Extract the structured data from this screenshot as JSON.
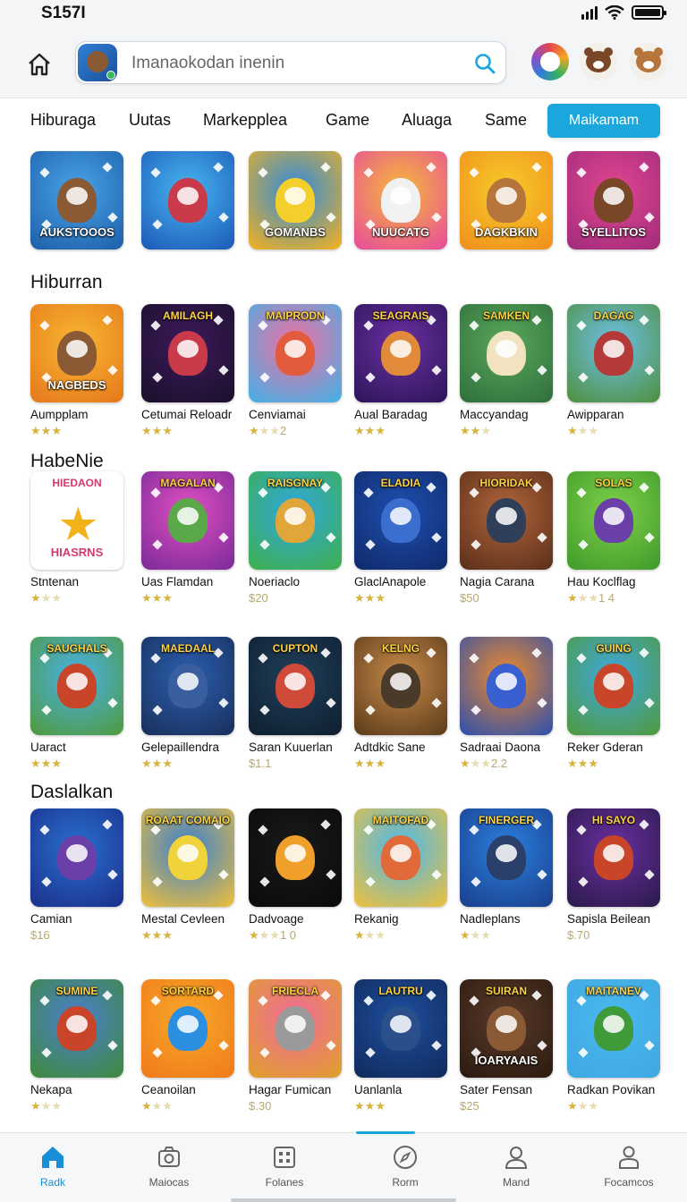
{
  "status_bar": {
    "time": "S157I"
  },
  "search": {
    "placeholder": "Imanaokodan inenin"
  },
  "tabs": [
    {
      "label": "Hiburaga"
    },
    {
      "label": "Uutas"
    },
    {
      "label": "Markepplea"
    },
    {
      "label": "Game"
    },
    {
      "label": "Aluaga"
    },
    {
      "label": "Same"
    },
    {
      "label": "Maikamam",
      "active": true
    }
  ],
  "featured": [
    {
      "banner_bottom": "AUKSTOOOS",
      "colors": [
        "#4aa3e8",
        "#1c5fa8"
      ],
      "char": "#8a5a34"
    },
    {
      "banner_bottom": "",
      "colors": [
        "#49b6f0",
        "#1b58b8"
      ],
      "char": "#c93a4a"
    },
    {
      "banner_bottom": "GOMANBS",
      "colors": [
        "#2d8be0",
        "#f6b21c"
      ],
      "char": "#f3cf2c"
    },
    {
      "banner_bottom": "NUUCATG",
      "colors": [
        "#f5b93a",
        "#e84a9c"
      ],
      "char": "#f1f1f1"
    },
    {
      "banner_bottom": "DAGKBKIN",
      "colors": [
        "#f7cb2a",
        "#f08e1c"
      ],
      "char": "#b5753b"
    },
    {
      "banner_bottom": "SYELLITOS",
      "colors": [
        "#e0468f",
        "#a12b7c"
      ],
      "char": "#7a4628"
    }
  ],
  "sections": [
    {
      "title": "Hiburran",
      "items": [
        {
          "name": "Aumpplam",
          "rating": 3,
          "price": "",
          "banner_top": "",
          "banner_bottom": "NAGBEDS",
          "colors": [
            "#f7b731",
            "#e6771c"
          ],
          "char": "#8a5a34"
        },
        {
          "name": "Cetumai Reloadr",
          "rating": 3,
          "price": "",
          "banner_top": "AMILAGH",
          "banner_bottom": "",
          "colors": [
            "#3d1a5c",
            "#1a0f2a"
          ],
          "char": "#c93a4a"
        },
        {
          "name": "Cenviamai",
          "rating": 1,
          "price": "2",
          "banner_top": "MAIPRODN",
          "banner_bottom": "",
          "colors": [
            "#f26fa1",
            "#3fb2e8"
          ],
          "char": "#e35b3d"
        },
        {
          "name": "Aual Baradag",
          "rating": 3,
          "price": "",
          "banner_top": "SEAGRAIS",
          "banner_bottom": "",
          "colors": [
            "#6b2fa3",
            "#2b1557"
          ],
          "char": "#e08a3a"
        },
        {
          "name": "Maccyandag",
          "rating": 2,
          "price": "",
          "banner_top": "SAMKEN",
          "banner_bottom": "",
          "colors": [
            "#5aa85a",
            "#2f6e3d"
          ],
          "char": "#f1e3c0"
        },
        {
          "name": "Awipparan",
          "rating": 1,
          "price": "",
          "banner_top": "DAGAG",
          "banner_bottom": "",
          "colors": [
            "#6cc0e8",
            "#4f8f3c"
          ],
          "char": "#b43a3a"
        }
      ]
    },
    {
      "title": "HabeNie",
      "items": [
        {
          "name": "Stntenan",
          "rating": 1,
          "price": "",
          "banner_top": "HIEDAON",
          "banner_bottom": "HIASRNS",
          "colors": [
            "#ffffff",
            "#ffffff"
          ],
          "char": "",
          "star": true
        },
        {
          "name": "Uas Flamdan",
          "rating": 3,
          "price": "",
          "banner_top": "MAGALAN",
          "banner_bottom": "",
          "colors": [
            "#e04fc0",
            "#7a2a9a"
          ],
          "char": "#5aa84a"
        },
        {
          "name": "Noeriaclo",
          "rating": 0,
          "price": "$20",
          "banner_top": "RAISGNAY",
          "banner_bottom": "",
          "colors": [
            "#2fa7e0",
            "#3fb04a"
          ],
          "char": "#e0a63a"
        },
        {
          "name": "GlaclAnapole",
          "rating": 3,
          "price": "",
          "banner_top": "ELADIA",
          "banner_bottom": "",
          "colors": [
            "#1f4fb0",
            "#0f2a6a"
          ],
          "char": "#3a6fd0"
        },
        {
          "name": "Nagia Carana",
          "rating": 0,
          "price": "$50",
          "banner_top": "HIORIDAK",
          "banner_bottom": "",
          "colors": [
            "#b0643a",
            "#5a2f1a"
          ],
          "char": "#2f3f5a"
        },
        {
          "name": "Hau Koclflag",
          "rating": 1,
          "price": "1 4",
          "banner_top": "SOLAS",
          "banner_bottom": "",
          "colors": [
            "#7fd04a",
            "#3f9a2a"
          ],
          "char": "#6a3fa8"
        }
      ]
    },
    {
      "title": "",
      "items": [
        {
          "name": "Uaract",
          "rating": 3,
          "price": "",
          "banner_top": "SAUGHALS",
          "banner_bottom": "",
          "colors": [
            "#4ab0e8",
            "#4f9a3a"
          ],
          "char": "#c8452a"
        },
        {
          "name": "Gelepaillendra",
          "rating": 3,
          "price": "",
          "banner_top": "MAEDAAL",
          "banner_bottom": "",
          "colors": [
            "#2a5fb0",
            "#1a2f5a"
          ],
          "char": "#3a5fa0"
        },
        {
          "name": "Saran Kuuerlan",
          "rating": 0,
          "price": "$1.1",
          "banner_top": "CUPTON",
          "banner_bottom": "",
          "colors": [
            "#1f3f5a",
            "#0f1f2f"
          ],
          "char": "#d04a3a"
        },
        {
          "name": "Adtdkic Sane",
          "rating": 3,
          "price": "",
          "banner_top": "KELNG",
          "banner_bottom": "",
          "colors": [
            "#c88a4a",
            "#5a3a1a"
          ],
          "char": "#4a3a2a"
        },
        {
          "name": "Sadraai Daona",
          "rating": 1,
          "price": "2.2",
          "banner_top": "",
          "banner_bottom": "",
          "colors": [
            "#f08a2a",
            "#2a4fb0"
          ],
          "char": "#3a5fd0"
        },
        {
          "name": "Reker Gderan",
          "rating": 3,
          "price": "",
          "banner_top": "GUING",
          "banner_bottom": "",
          "colors": [
            "#3fa8e0",
            "#4f9a3a"
          ],
          "char": "#c8452a"
        }
      ]
    },
    {
      "title": "Daslalkan",
      "items": [
        {
          "name": "Camian",
          "rating": 0,
          "price": "$16",
          "banner_top": "",
          "banner_bottom": "",
          "colors": [
            "#2a6fd0",
            "#1a2f8a"
          ],
          "char": "#6a3fa8"
        },
        {
          "name": "Mestal Cevleen",
          "rating": 3,
          "price": "",
          "banner_top": "ROAAT COMAIO",
          "banner_bottom": "",
          "colors": [
            "#3a7fd0",
            "#f0c03a"
          ],
          "char": "#f0d23a"
        },
        {
          "name": "Dadvoage",
          "rating": 1,
          "price": "1 0",
          "banner_top": "",
          "banner_bottom": "",
          "colors": [
            "#1a1a1a",
            "#0a0a0a"
          ],
          "char": "#f0a02a"
        },
        {
          "name": "Rekanig",
          "rating": 1,
          "price": "",
          "banner_top": "MAITOFAD",
          "banner_bottom": "",
          "colors": [
            "#4ab8f0",
            "#f0c03a"
          ],
          "char": "#e06a3a"
        },
        {
          "name": "Nadleplans",
          "rating": 1,
          "price": "",
          "banner_top": "FINERGER",
          "banner_bottom": "",
          "colors": [
            "#2a7fe0",
            "#1a3f8a"
          ],
          "char": "#2a3f6a"
        },
        {
          "name": "Sapisla Beilean",
          "rating": 0,
          "price": "$.70",
          "banner_top": "HI SAYO",
          "banner_bottom": "",
          "colors": [
            "#6a2fa0",
            "#2a1a4a"
          ],
          "char": "#c8452a"
        }
      ]
    },
    {
      "title": "",
      "items": [
        {
          "name": "Nekapa",
          "rating": 1,
          "price": "",
          "banner_top": "SUMINE",
          "banner_bottom": "",
          "colors": [
            "#4a7fd0",
            "#3f8a3a"
          ],
          "char": "#c8452a"
        },
        {
          "name": "Ceanoilan",
          "rating": 1,
          "price": "",
          "banner_top": "SORTARD",
          "banner_bottom": "",
          "colors": [
            "#f7a82a",
            "#f07a1a"
          ],
          "char": "#2a8fe0"
        },
        {
          "name": "Hagar Fumican",
          "rating": 0,
          "price": "$.30",
          "banner_top": "FRIECLA",
          "banner_bottom": "",
          "colors": [
            "#f06a9a",
            "#e0a02a"
          ],
          "char": "#9a9a9a"
        },
        {
          "name": "Uanlanla",
          "rating": 3,
          "price": "",
          "banner_top": "LAUTRU",
          "banner_bottom": "",
          "colors": [
            "#1f4fa0",
            "#0f2a5a"
          ],
          "char": "#2a4f8a"
        },
        {
          "name": "Sater Fensan",
          "rating": 0,
          "price": "$25",
          "banner_top": "SUIRAN",
          "banner_bottom": "IOARYAAIS",
          "colors": [
            "#5a3a2a",
            "#2a1a10"
          ],
          "char": "#8a5a34"
        },
        {
          "name": "Radkan Povikan",
          "rating": 1,
          "price": "",
          "banner_top": "MAITANEV",
          "banner_bottom": "",
          "colors": [
            "#4ab8f0",
            "#3fa8e0"
          ],
          "char": "#3f9a3a"
        }
      ]
    }
  ],
  "bottom_nav": [
    {
      "label": "Radk",
      "icon": "home-icon",
      "active": true
    },
    {
      "label": "Maiocas",
      "icon": "camera-icon"
    },
    {
      "label": "Folanes",
      "icon": "grid-icon"
    },
    {
      "label": "Rorm",
      "icon": "compass-icon"
    },
    {
      "label": "Mand",
      "icon": "person-icon"
    },
    {
      "label": "Focamcos",
      "icon": "profile-icon"
    }
  ],
  "colors": {
    "accent": "#1ba7db",
    "rating_star": "#d8b53a",
    "nav_active": "#1a8fd6"
  }
}
